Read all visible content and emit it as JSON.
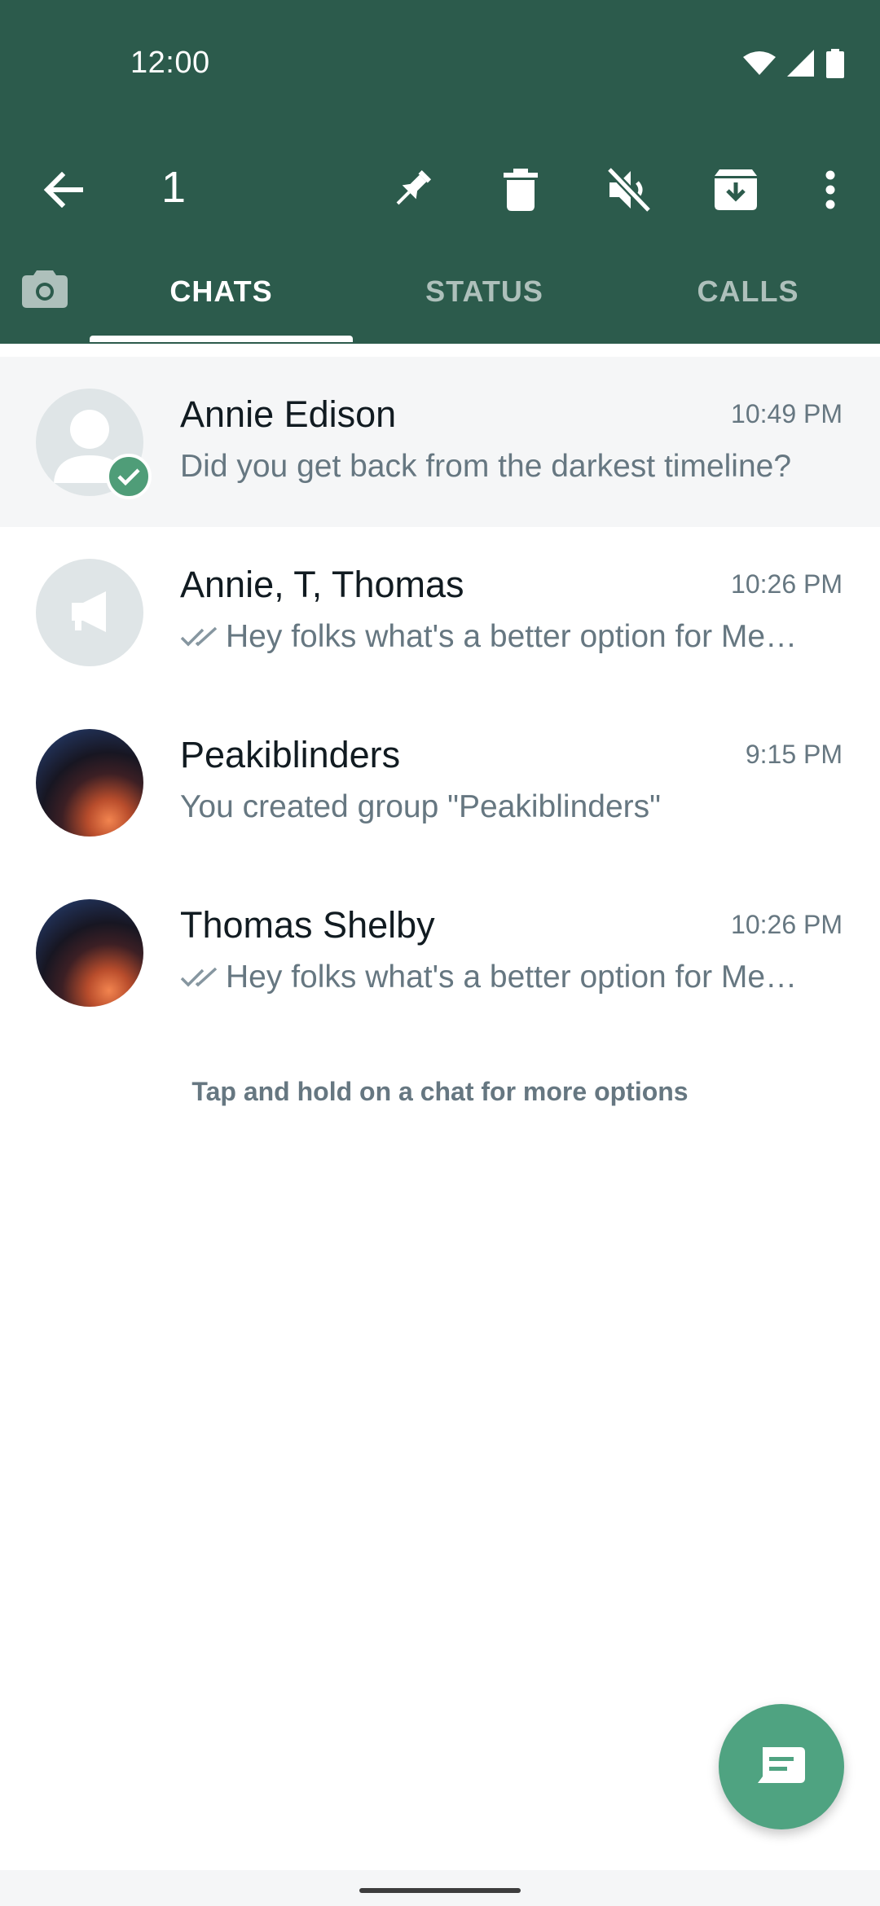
{
  "colors": {
    "header_bg": "#2c5b4c",
    "accent": "#4fa381",
    "selected_row_bg": "#f5f6f7"
  },
  "status_bar": {
    "time": "12:00",
    "icons": [
      "wifi-icon",
      "signal-icon",
      "battery-icon"
    ]
  },
  "action_bar": {
    "selected_count": "1",
    "icons": [
      "back-arrow-icon",
      "pin-icon",
      "delete-icon",
      "mute-icon",
      "archive-icon",
      "more-options-icon"
    ]
  },
  "tabs": {
    "camera_icon": "camera-icon",
    "items": [
      {
        "label": "CHATS",
        "active": true
      },
      {
        "label": "STATUS",
        "active": false
      },
      {
        "label": "CALLS",
        "active": false
      }
    ]
  },
  "chats": [
    {
      "name": "Annie Edison",
      "time": "10:49 PM",
      "message": "Did you get back from the darkest timeline?",
      "selected": true,
      "avatar": "person-placeholder-icon",
      "read_ticks": false
    },
    {
      "name": "Annie, T, Thomas",
      "time": "10:26 PM",
      "message": "Hey folks what's a better option for Me…",
      "selected": false,
      "avatar": "broadcast-megaphone-icon",
      "read_ticks": true
    },
    {
      "name": "Peakiblinders",
      "time": "9:15 PM",
      "message": "You created group \"Peakiblinders\"",
      "selected": false,
      "avatar": "photo",
      "read_ticks": false
    },
    {
      "name": "Thomas Shelby",
      "time": "10:26 PM",
      "message": "Hey folks what's a better option for Me…",
      "selected": false,
      "avatar": "photo",
      "read_ticks": true
    }
  ],
  "hint": "Tap and hold on a chat for more options",
  "fab": {
    "icon": "new-chat-icon"
  }
}
